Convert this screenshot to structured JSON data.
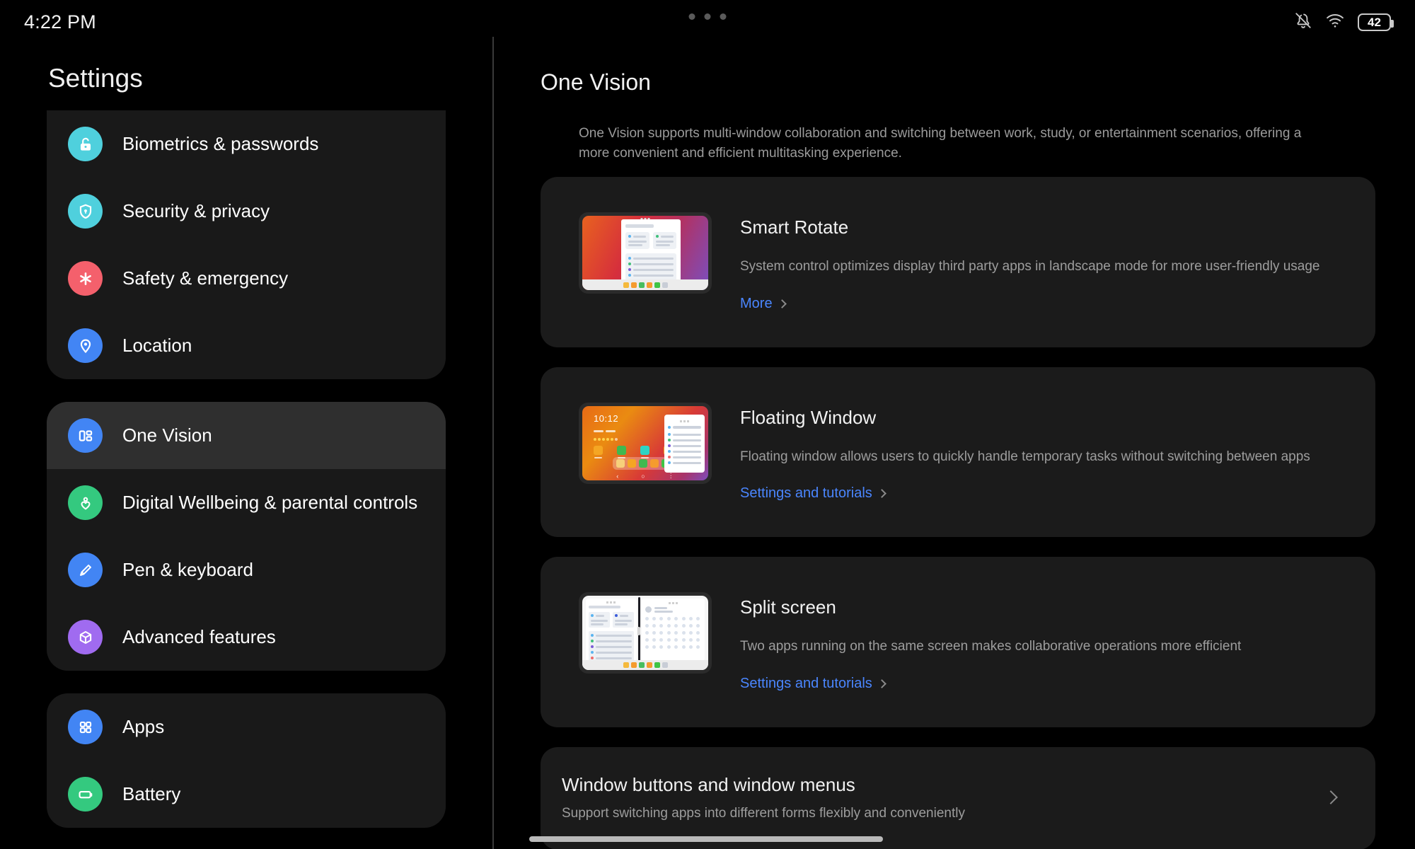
{
  "status_bar": {
    "time": "4:22 PM",
    "battery_level": "42",
    "icons": [
      "notifications-off-icon",
      "wifi-icon",
      "battery-icon"
    ]
  },
  "sidebar": {
    "title": "Settings",
    "groups": [
      {
        "items": [
          {
            "label": "Biometrics & passwords",
            "icon": "lock-icon",
            "color": "#4fd0dd",
            "selected": false
          },
          {
            "label": "Security & privacy",
            "icon": "shield-icon",
            "color": "#4fd0dd",
            "selected": false
          },
          {
            "label": "Safety & emergency",
            "icon": "asterisk-icon",
            "color": "#f4606c",
            "selected": false
          },
          {
            "label": "Location",
            "icon": "pin-icon",
            "color": "#4285f4",
            "selected": false
          }
        ]
      },
      {
        "items": [
          {
            "label": "One Vision",
            "icon": "multiwindow-icon",
            "color": "#4285f4",
            "selected": true
          },
          {
            "label": "Digital Wellbeing & parental controls",
            "icon": "wellbeing-icon",
            "color": "#34c97f",
            "selected": false
          },
          {
            "label": "Pen & keyboard",
            "icon": "pencil-icon",
            "color": "#4285f4",
            "selected": false
          },
          {
            "label": "Advanced features",
            "icon": "cube-icon",
            "color": "#a06bf0",
            "selected": false
          }
        ]
      },
      {
        "items": [
          {
            "label": "Apps",
            "icon": "apps-grid-icon",
            "color": "#4285f4",
            "selected": false
          },
          {
            "label": "Battery",
            "icon": "battery-icon",
            "color": "#34c97f",
            "selected": false
          }
        ]
      }
    ]
  },
  "main": {
    "title": "One Vision",
    "description": "One Vision supports multi-window collaboration and switching between work, study, or entertainment scenarios, offering a more convenient and efficient multitasking experience.",
    "cards": [
      {
        "title": "Smart Rotate",
        "description": "System control optimizes display third party apps in landscape mode for more user-friendly usage",
        "link": "More",
        "thumbnail": "smart-rotate-thumbnail"
      },
      {
        "title": "Floating Window",
        "description": "Floating window allows users to quickly handle temporary tasks without switching between apps",
        "link": "Settings and tutorials",
        "thumbnail": "floating-window-thumbnail",
        "thumbnail_clock": "10:12"
      },
      {
        "title": "Split screen",
        "description": "Two apps running on the same screen makes collaborative operations more efficient",
        "link": "Settings and tutorials",
        "thumbnail": "split-screen-thumbnail"
      }
    ],
    "wide_row": {
      "title": "Window buttons and window menus",
      "description": "Support switching apps into different forms flexibly and conveniently"
    }
  },
  "colors": {
    "accent_link": "#4a86ff",
    "card_bg": "#1b1b1b",
    "page_bg": "#000000",
    "group_bg": "#191919",
    "selected_bg": "#2f2f2f"
  }
}
